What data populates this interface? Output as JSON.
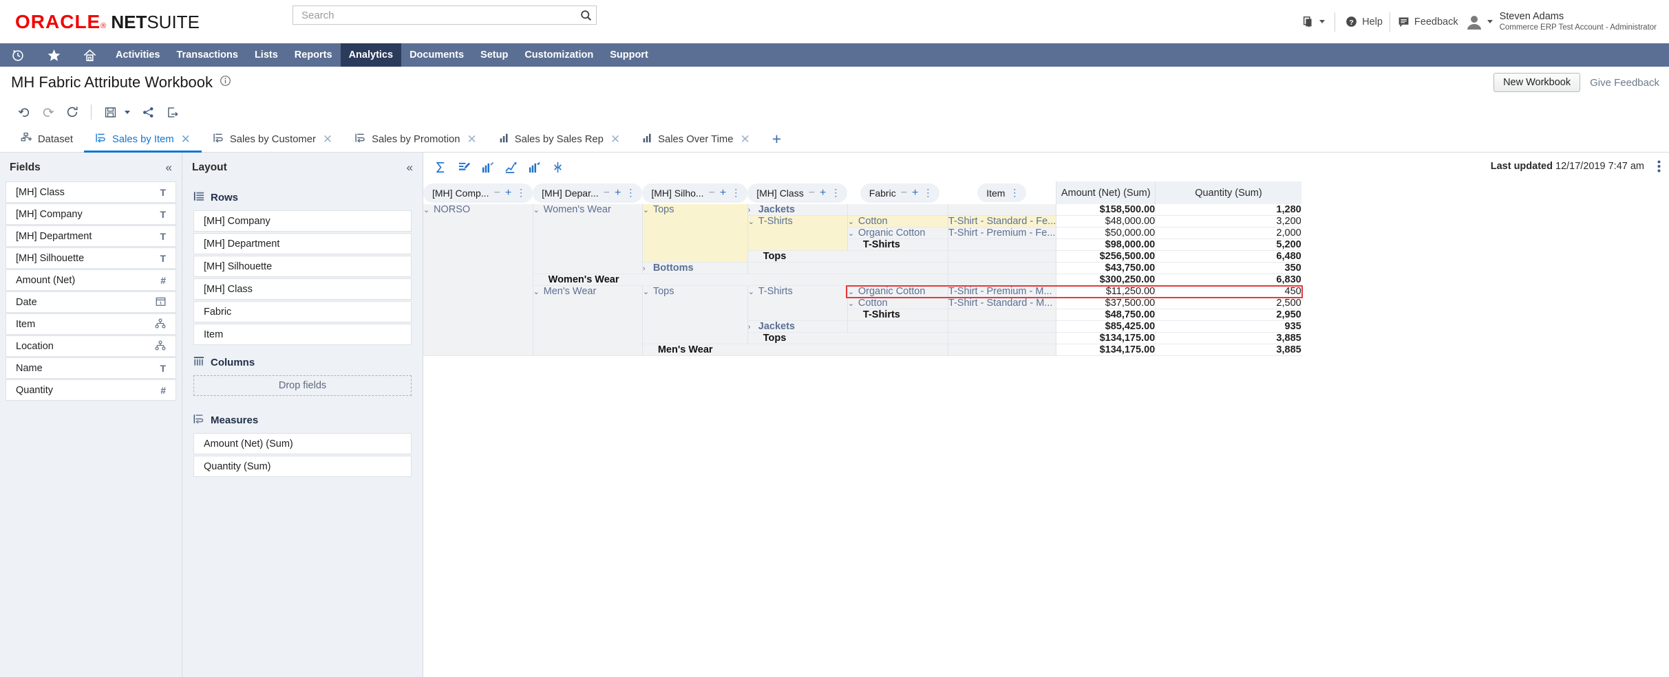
{
  "header": {
    "logo": {
      "oracle": "ORACLE",
      "net": "NET",
      "suite": "SUITE"
    },
    "search": {
      "placeholder": "Search",
      "value": ""
    },
    "help_label": "Help",
    "feedback_label": "Feedback",
    "user_name": "Steven Adams",
    "user_role": "Commerce ERP Test Account - Administrator"
  },
  "nav": {
    "items": [
      {
        "label": "Activities",
        "active": false
      },
      {
        "label": "Transactions",
        "active": false
      },
      {
        "label": "Lists",
        "active": false
      },
      {
        "label": "Reports",
        "active": false
      },
      {
        "label": "Analytics",
        "active": true
      },
      {
        "label": "Documents",
        "active": false
      },
      {
        "label": "Setup",
        "active": false
      },
      {
        "label": "Customization",
        "active": false
      },
      {
        "label": "Support",
        "active": false
      }
    ]
  },
  "workbook": {
    "title": "MH Fabric Attribute Workbook",
    "new_workbook_label": "New Workbook",
    "give_feedback_label": "Give Feedback"
  },
  "tabs": [
    {
      "label": "Dataset",
      "icon": "dataset-icon",
      "active": false,
      "closable": false
    },
    {
      "label": "Sales by Item",
      "icon": "pivot-icon",
      "active": true,
      "closable": true
    },
    {
      "label": "Sales by Customer",
      "icon": "pivot-icon",
      "active": false,
      "closable": true
    },
    {
      "label": "Sales by Promotion",
      "icon": "pivot-icon",
      "active": false,
      "closable": true
    },
    {
      "label": "Sales by Sales Rep",
      "icon": "chart-icon",
      "active": false,
      "closable": true
    },
    {
      "label": "Sales Over Time",
      "icon": "chart-icon",
      "active": false,
      "closable": true
    }
  ],
  "fields_panel": {
    "title": "Fields",
    "items": [
      {
        "label": "[MH] Class",
        "type": "T"
      },
      {
        "label": "[MH] Company",
        "type": "T"
      },
      {
        "label": "[MH] Department",
        "type": "T"
      },
      {
        "label": "[MH] Silhouette",
        "type": "T"
      },
      {
        "label": "Amount (Net)",
        "type": "#"
      },
      {
        "label": "Date",
        "type": "date"
      },
      {
        "label": "Item",
        "type": "hierarchy"
      },
      {
        "label": "Location",
        "type": "hierarchy"
      },
      {
        "label": "Name",
        "type": "T"
      },
      {
        "label": "Quantity",
        "type": "#"
      }
    ]
  },
  "layout_panel": {
    "title": "Layout",
    "rows_label": "Rows",
    "rows": [
      "[MH] Company",
      "[MH] Department",
      "[MH] Silhouette",
      "[MH] Class",
      "Fabric",
      "Item"
    ],
    "columns_label": "Columns",
    "columns_placeholder": "Drop fields",
    "measures_label": "Measures",
    "measures": [
      "Amount (Net) (Sum)",
      "Quantity (Sum)"
    ]
  },
  "pivot": {
    "last_updated_label": "Last updated",
    "last_updated_value": "12/17/2019 7:47 am",
    "dimension_headers": [
      {
        "label": "[MH] Comp...",
        "collapse": "−",
        "expand": "+"
      },
      {
        "label": "[MH] Depar...",
        "collapse": "−",
        "expand": "+"
      },
      {
        "label": "[MH] Silho...",
        "collapse": "−",
        "expand": "+"
      },
      {
        "label": "[MH] Class",
        "collapse": "−",
        "expand": "+"
      },
      {
        "label": "Fabric",
        "collapse": "−",
        "expand": "+"
      },
      {
        "label": "Item",
        "collapse": "",
        "expand": ""
      }
    ],
    "measure_headers": [
      "Amount (Net) (Sum)",
      "Quantity (Sum)"
    ],
    "rows": [
      {
        "company": "NORSO",
        "company_state": "expanded",
        "department": "Women's Wear",
        "department_state": "expanded",
        "silhouette": "Tops",
        "silhouette_state": "expanded",
        "silhouette_hl": true,
        "cls": "Jackets",
        "cls_state": "collapsed",
        "cls_hl": false,
        "fabric": "",
        "fabric_hl": false,
        "item": "",
        "amount": "$158,500.00",
        "quantity": "1,280",
        "bold": true
      },
      {
        "company": "",
        "department": "",
        "silhouette": "",
        "silhouette_hl": true,
        "cls": "T-Shirts",
        "cls_state": "expanded",
        "cls_hl": true,
        "fabric": "Cotton",
        "fabric_state": "expanded",
        "fabric_hl": true,
        "item": "T-Shirt - Standard - Fe...",
        "item_hl": true,
        "amount": "$48,000.00",
        "quantity": "3,200",
        "bold": false
      },
      {
        "company": "",
        "department": "",
        "silhouette": "",
        "silhouette_hl": true,
        "cls": "",
        "cls_hl": true,
        "fabric": "Organic Cotton",
        "fabric_state": "expanded",
        "fabric_hl": false,
        "item": "T-Shirt - Premium - Fe...",
        "item_hl": false,
        "amount": "$50,000.00",
        "quantity": "2,000",
        "bold": false
      },
      {
        "company": "",
        "department": "",
        "silhouette": "",
        "silhouette_hl": true,
        "cls": "",
        "cls_hl": true,
        "fabric": "T-Shirts",
        "fabric_total": true,
        "fabric_hl": false,
        "item": "",
        "amount": "$98,000.00",
        "quantity": "5,200",
        "bold": true
      },
      {
        "company": "",
        "department": "",
        "silhouette": "",
        "silhouette_hl": true,
        "cls": "Tops",
        "cls_total": true,
        "cls_hl": false,
        "fabric": "",
        "item": "",
        "amount": "$256,500.00",
        "quantity": "6,480",
        "bold": true
      },
      {
        "company": "",
        "department": "",
        "silhouette": "Bottoms",
        "silhouette_state": "collapsed",
        "silhouette_total": true,
        "silhouette_hl": false,
        "cls": "",
        "fabric": "",
        "item": "",
        "amount": "$43,750.00",
        "quantity": "350",
        "bold": true
      },
      {
        "company": "",
        "department": "Women's Wear",
        "department_total": true,
        "silhouette": "",
        "cls": "",
        "fabric": "",
        "item": "",
        "amount": "$300,250.00",
        "quantity": "6,830",
        "bold": true
      },
      {
        "company": "",
        "department": "Men's Wear",
        "department_state": "expanded",
        "silhouette": "Tops",
        "silhouette_state": "expanded",
        "silhouette_hl": false,
        "cls": "T-Shirts",
        "cls_state": "expanded",
        "cls_hl": false,
        "fabric": "Organic Cotton",
        "fabric_state": "expanded",
        "fabric_hl": false,
        "item": "T-Shirt - Premium - M...",
        "item_hl": false,
        "amount": "$11,250.00",
        "quantity": "450",
        "bold": false,
        "selected": true
      },
      {
        "company": "",
        "department": "",
        "silhouette": "",
        "cls": "",
        "fabric": "Cotton",
        "fabric_state": "expanded",
        "fabric_hl": false,
        "item": "T-Shirt - Standard - M...",
        "item_hl": false,
        "amount": "$37,500.00",
        "quantity": "2,500",
        "bold": false
      },
      {
        "company": "",
        "department": "",
        "silhouette": "",
        "cls": "",
        "fabric": "T-Shirts",
        "fabric_total": true,
        "item": "",
        "amount": "$48,750.00",
        "quantity": "2,950",
        "bold": true
      },
      {
        "company": "",
        "department": "",
        "silhouette": "",
        "cls": "Jackets",
        "cls_state": "collapsed",
        "cls_hl": false,
        "fabric": "",
        "item": "",
        "amount": "$85,425.00",
        "quantity": "935",
        "bold": true
      },
      {
        "company": "",
        "department": "",
        "silhouette": "",
        "cls": "Tops",
        "cls_total": true,
        "fabric": "",
        "item": "",
        "amount": "$134,175.00",
        "quantity": "3,885",
        "bold": true
      },
      {
        "company": "",
        "department": "",
        "silhouette": "Men's Wear",
        "silhouette_total": true,
        "cls": "",
        "fabric": "",
        "item": "",
        "amount": "$134,175.00",
        "quantity": "3,885",
        "bold": true
      }
    ]
  },
  "colors": {
    "nav_bg": "#5b6f94",
    "nav_active": "#2b3b5c",
    "accent_blue": "#1276d3",
    "highlight_yellow": "#faf3cf",
    "selection_red": "#e8373a",
    "oracle_red": "#f20000"
  }
}
